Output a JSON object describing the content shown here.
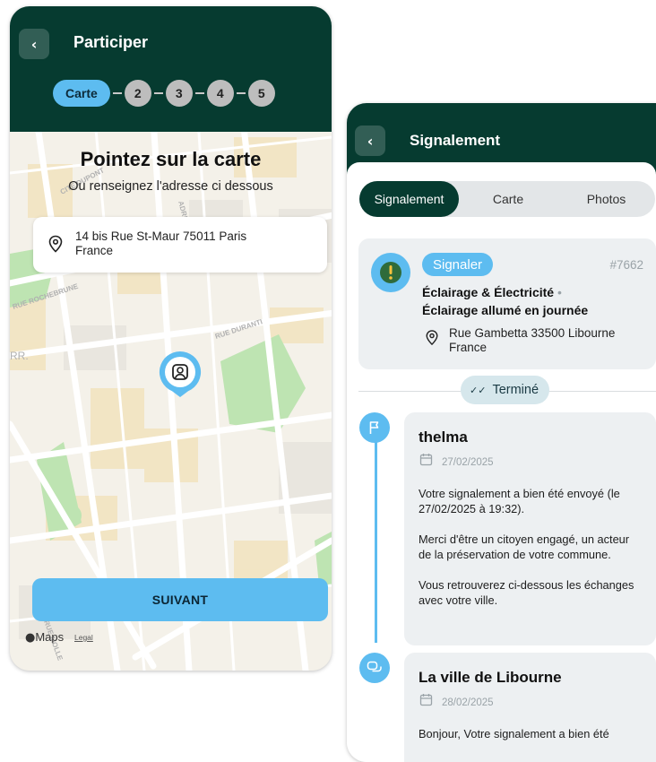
{
  "screen1": {
    "header_title": "Participer",
    "steps": [
      "Carte",
      "2",
      "3",
      "4",
      "5"
    ],
    "heading": "Pointez sur la carte",
    "subheading": "Ou renseignez l'adresse ci dessous",
    "address_line1": "14 bis Rue St-Maur 75011 Paris",
    "address_line2": "France",
    "map_labels": [
      "CITÉ DUPONT",
      "ADRESSE",
      "RUE ROCHEBRUNE",
      "RUE DURANTI",
      "RR.",
      "RUE MOLLE"
    ],
    "next_button": "SUIVANT",
    "maps_brand": "Maps",
    "legal_link": "Legal"
  },
  "screen2": {
    "header_title": "Signalement",
    "tabs": [
      "Signalement",
      "Carte",
      "Photos"
    ],
    "report": {
      "badge": "Signaler",
      "id": "#7662",
      "category": "Éclairage & Électricité",
      "subcategory": "Éclairage allumé en journée",
      "address_line1": "Rue Gambetta 33500 Libourne",
      "address_line2": "France"
    },
    "status": "Terminé",
    "messages": [
      {
        "author": "thelma",
        "date": "27/02/2025",
        "paragraphs": [
          "Votre signalement a bien été envoyé (le 27/02/2025 à 19:32).",
          "Merci d'être un citoyen engagé, un acteur de la préservation de votre commune.",
          "Vous retrouverez ci-dessous les échanges avec votre ville."
        ]
      },
      {
        "author": "La ville de Libourne",
        "date": "28/02/2025",
        "paragraphs": [
          "Bonjour, Votre signalement a bien été"
        ]
      }
    ]
  },
  "colors": {
    "header_green": "#063b30",
    "accent_blue": "#5dbcf0",
    "card_grey": "#edf0f2",
    "park_green": "#8fd07a"
  },
  "icons": [
    "back-chevron-icon",
    "location-pin-icon",
    "user-pin-icon",
    "alert-icon",
    "double-check-icon",
    "flag-icon",
    "chat-icon",
    "calendar-icon",
    "apple-logo-icon"
  ]
}
